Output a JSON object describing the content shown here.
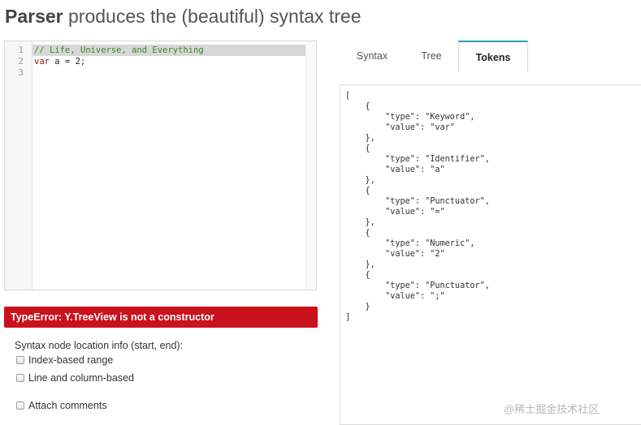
{
  "header": {
    "title_bold": "Parser",
    "title_rest": " produces the (beautiful) syntax tree"
  },
  "editor": {
    "line_numbers": [
      "1",
      "2",
      "3"
    ],
    "code": {
      "line1": "// Life, Universe, and Everything",
      "line2_kw": "var",
      "line2_rest": " a = 2;",
      "line3": ""
    }
  },
  "error": {
    "message": "TypeError: Y.TreeView is not a constructor"
  },
  "options": {
    "title": "Syntax node location info (start, end):",
    "index_range": "Index-based range",
    "line_column": "Line and column-based",
    "attach_comments": "Attach comments"
  },
  "tabs": {
    "syntax": "Syntax",
    "tree": "Tree",
    "tokens": "Tokens",
    "active": "Tokens"
  },
  "output": {
    "tokens_json": "[\n    {\n        \"type\": \"Keyword\",\n        \"value\": \"var\"\n    },\n    {\n        \"type\": \"Identifier\",\n        \"value\": \"a\"\n    },\n    {\n        \"type\": \"Punctuator\",\n        \"value\": \"=\"\n    },\n    {\n        \"type\": \"Numeric\",\n        \"value\": \"2\"\n    },\n    {\n        \"type\": \"Punctuator\",\n        \"value\": \";\"\n    }\n]"
  },
  "watermark": "@稀土掘金技术社区",
  "colors": {
    "error_bg": "#c9121b",
    "tab_accent": "#27a3b4",
    "comment": "#3a8a22",
    "keyword": "#8b0f0f"
  }
}
